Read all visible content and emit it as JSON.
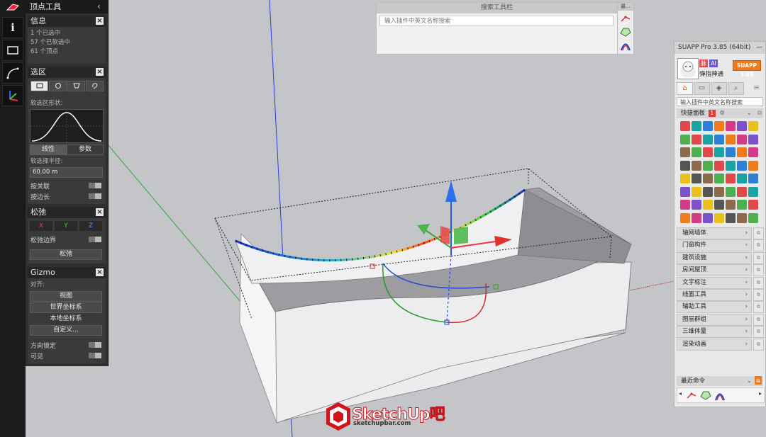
{
  "vertex_panel": {
    "title": "顶点工具",
    "info": {
      "header": "信息",
      "selected": "1 个已选中",
      "soft_selected": "57 个已软选中",
      "vertices": "61 个顶点"
    },
    "selection": {
      "header": "选区",
      "soft_shape_label": "软选区形状:",
      "linear": "线性",
      "param": "参数",
      "radius_label": "软选择半径:",
      "radius_value": "60.00 m",
      "by_connect": "按关联",
      "by_edge": "按边长"
    },
    "relax": {
      "header": "松弛",
      "x": "X",
      "y": "Y",
      "z": "Z",
      "relax_border": "松弛边界",
      "relax_btn": "松弛"
    },
    "gizmo": {
      "header": "Gizmo",
      "align_label": "对齐:",
      "view": "视图",
      "world": "世界坐标系",
      "local": "本地坐标系",
      "custom": "自定义...",
      "lock_dir": "方向锁定",
      "visible": "可见"
    }
  },
  "left_toolbar": {
    "info_icon": "i"
  },
  "search_toolbar": {
    "title": "搜索工具栏",
    "placeholder": "输入插件中英文名称搜索"
  },
  "mini_toolbar": {
    "title": "最..."
  },
  "suapp": {
    "title": "SUAPP Pro 3.85 (64bit)",
    "minimize": "—",
    "badge1": "脉",
    "badge2": "AI",
    "username": "弹指神通",
    "version_badge": "SUAPP 3.85",
    "search_text": "输入插件中英文名称搜索",
    "quick_panel": "快捷面板",
    "quick_num": "1",
    "categories": [
      "轴网墙体",
      "门窗构件",
      "建筑设施",
      "房间屋顶",
      "文字标注",
      "线面工具",
      "辅助工具",
      "图层群组",
      "三维体量",
      "渲染动画"
    ],
    "recent": "最近命令"
  },
  "logo": {
    "main": "SketchUp吧",
    "sub": "sketchupbar.com"
  },
  "colors": {
    "accent": "#f07b1c",
    "panel": "#2f2f2f",
    "viewport": "#c4c5c9",
    "logo_red": "#c4161c"
  }
}
